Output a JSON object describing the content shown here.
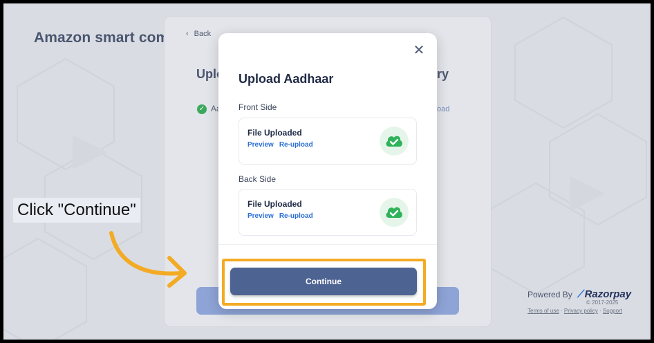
{
  "background": {
    "brand_title": "Amazon smart comm",
    "back_label": "Back",
    "card_heading_left": "Uplo",
    "card_heading_right": "ry",
    "card_check_text": "Aa",
    "card_right_link": "oad"
  },
  "modal": {
    "title": "Upload Aadhaar",
    "close_icon": "close-icon",
    "front": {
      "label": "Front Side",
      "status": "File Uploaded",
      "preview": "Preview",
      "reupload": "Re-upload",
      "icon": "cloud-check-icon"
    },
    "back": {
      "label": "Back Side",
      "status": "File Uploaded",
      "preview": "Preview",
      "reupload": "Re-upload",
      "icon": "cloud-check-icon"
    },
    "continue_label": "Continue"
  },
  "footer": {
    "powered_by": "Powered By",
    "brand": "Razorpay",
    "copyright": "© 2017-2025",
    "terms": "Terms of use",
    "privacy": "Privacy policy",
    "support": "Support"
  },
  "tutorial": {
    "instruction": "Click \"Continue\"",
    "highlight_color": "#f3ab25"
  },
  "colors": {
    "primary_button": "#4d6392",
    "success": "#2fb35a",
    "link": "#2b6fd6"
  }
}
